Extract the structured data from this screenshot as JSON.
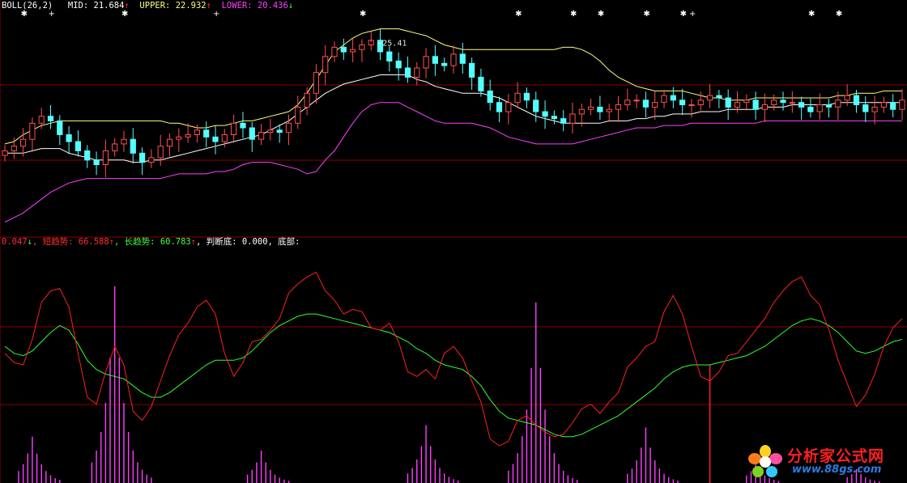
{
  "upper_panel": {
    "indicator": "BOLL(26,2)",
    "mid": {
      "label": "MID:",
      "value": "21.684",
      "arrow": "↑",
      "color": "#ffffff"
    },
    "upper": {
      "label": "UPPER:",
      "value": "22.932",
      "arrow": "↑",
      "color": "#ffff80"
    },
    "lower": {
      "label": "LOWER:",
      "value": "20.436",
      "arrow": "↓",
      "color": "#ff40ff"
    },
    "peak_annotation": "←25.41"
  },
  "lower_panel": {
    "lead_value": "0.047",
    "lead_arrow": "↓",
    "short_trend": {
      "label": "短趋势:",
      "value": "66.588",
      "arrow": "↑",
      "color": "#ff3030"
    },
    "long_trend": {
      "label": "长趋势:",
      "value": "60.783",
      "arrow": "↑",
      "color": "#40ff40"
    },
    "judge_bottom": {
      "label": "判断底:",
      "value": "0.000,"
    },
    "bottom": {
      "label": "底部:"
    }
  },
  "watermark": {
    "title": "分析家公式网",
    "url": "www.88gs.com"
  },
  "colors": {
    "background": "#000000",
    "rise_candle": "#ff5050",
    "fall_candle": "#54ffff",
    "boll_mid": "#ffffff",
    "boll_upper": "#ffff80",
    "boll_lower": "#ff40ff",
    "short_trend": "#ff2020",
    "long_trend": "#30ff30",
    "histogram": "#ff40ff",
    "grid": "#8b0000"
  },
  "chart_data": [
    {
      "type": "candlestick",
      "title": "BOLL(26,2)",
      "note": "approximate daily candles read off the price panel",
      "series": [
        {
          "name": "UPPER",
          "values": [
            21.0,
            21.1,
            21.4,
            21.6,
            21.8,
            21.9,
            22.0,
            22.0,
            22.0,
            22.0,
            22.0,
            22.0,
            22.0,
            22.0,
            22.0,
            22.0,
            22.0,
            22.0,
            21.9,
            21.9,
            21.8,
            21.7,
            21.7,
            21.8,
            21.8,
            21.9,
            22.0,
            22.0,
            22.1,
            22.2,
            22.3,
            22.4,
            22.7,
            23.2,
            23.8,
            24.4,
            25.0,
            25.3,
            25.6,
            25.8,
            25.9,
            26.0,
            26.0,
            26.0,
            25.9,
            25.8,
            25.7,
            25.5,
            25.3,
            25.2,
            25.1,
            25.1,
            25.1,
            25.1,
            25.1,
            25.1,
            25.1,
            25.1,
            25.1,
            25.1,
            25.1,
            25.2,
            25.2,
            25.1,
            24.9,
            24.6,
            24.2,
            23.9,
            23.7,
            23.5,
            23.4,
            23.3,
            23.3,
            23.3,
            23.3,
            23.2,
            23.1,
            23.0,
            23.0,
            22.9,
            22.9,
            22.9,
            23.0,
            23.0,
            23.0,
            23.0,
            23.0,
            23.0,
            23.0,
            23.0,
            23.0,
            23.1,
            23.1,
            23.2,
            23.2,
            23.2,
            23.3,
            23.3,
            23.3
          ]
        },
        {
          "name": "MID",
          "values": [
            20.6,
            20.6,
            20.6,
            20.7,
            20.8,
            20.8,
            20.8,
            20.6,
            20.5,
            20.4,
            20.3,
            20.3,
            20.3,
            20.3,
            20.2,
            20.2,
            20.3,
            20.3,
            20.4,
            20.5,
            20.6,
            20.7,
            20.8,
            20.9,
            21.0,
            21.1,
            21.2,
            21.3,
            21.4,
            21.6,
            21.8,
            22.0,
            22.3,
            22.6,
            22.9,
            23.2,
            23.4,
            23.6,
            23.7,
            23.8,
            23.9,
            24.0,
            24.0,
            24.0,
            24.0,
            23.8,
            23.7,
            23.5,
            23.4,
            23.3,
            23.2,
            23.2,
            23.2,
            23.1,
            23.0,
            22.8,
            22.6,
            22.4,
            22.2,
            22.1,
            22.0,
            21.9,
            21.9,
            21.9,
            21.9,
            21.9,
            22.0,
            22.0,
            22.0,
            22.1,
            22.1,
            22.2,
            22.2,
            22.3,
            22.3,
            22.3,
            22.4,
            22.4,
            22.4,
            22.5,
            22.5,
            22.5,
            22.5,
            22.6,
            22.6,
            22.6,
            22.7,
            22.7,
            22.7,
            22.7,
            22.7,
            22.8,
            22.8,
            22.8,
            22.8,
            22.8,
            22.8,
            22.8,
            22.8
          ]
        },
        {
          "name": "LOWER",
          "values": [
            17.6,
            17.8,
            18.0,
            18.3,
            18.6,
            18.9,
            19.1,
            19.3,
            19.4,
            19.5,
            19.5,
            19.5,
            19.5,
            19.5,
            19.5,
            19.5,
            19.5,
            19.5,
            19.6,
            19.7,
            19.7,
            19.7,
            19.7,
            19.8,
            19.8,
            19.9,
            20.1,
            20.2,
            20.2,
            20.2,
            20.1,
            20.0,
            19.9,
            19.7,
            19.8,
            20.3,
            20.7,
            21.3,
            21.9,
            22.4,
            22.7,
            22.8,
            22.8,
            22.8,
            22.6,
            22.4,
            22.2,
            22.0,
            21.9,
            21.9,
            21.9,
            21.9,
            21.8,
            21.7,
            21.5,
            21.3,
            21.2,
            21.1,
            21.0,
            21.0,
            21.0,
            21.0,
            21.0,
            21.1,
            21.2,
            21.3,
            21.4,
            21.5,
            21.6,
            21.7,
            21.7,
            21.7,
            21.8,
            21.8,
            21.8,
            21.9,
            21.9,
            21.9,
            21.9,
            21.9,
            21.9,
            21.9,
            21.9,
            22.0,
            22.0,
            22.0,
            22.0,
            22.0,
            22.0,
            22.0,
            22.0,
            22.0,
            22.0,
            22.0,
            22.0,
            22.0,
            22.0,
            22.0,
            22.0
          ]
        }
      ],
      "close": [
        20.7,
        20.9,
        21.2,
        21.9,
        22.2,
        22.0,
        21.4,
        21.1,
        20.7,
        20.3,
        20.1,
        20.7,
        21.0,
        21.2,
        20.6,
        20.2,
        20.4,
        20.9,
        21.2,
        21.3,
        21.4,
        21.6,
        21.3,
        21.1,
        21.4,
        21.9,
        21.7,
        21.2,
        21.5,
        21.6,
        21.5,
        21.9,
        22.6,
        23.2,
        24.1,
        24.8,
        25.2,
        25.0,
        25.1,
        25.3,
        25.5,
        25.0,
        24.6,
        24.3,
        23.9,
        24.3,
        24.8,
        24.5,
        24.4,
        24.9,
        24.5,
        23.9,
        23.3,
        22.8,
        22.4,
        22.8,
        23.2,
        22.9,
        22.4,
        22.2,
        22.1,
        21.9,
        22.3,
        22.5,
        22.6,
        22.4,
        22.5,
        22.7,
        22.9,
        22.9,
        22.6,
        22.8,
        23.1,
        22.9,
        22.7,
        22.7,
        22.9,
        23.1,
        23.0,
        22.6,
        22.8,
        22.9,
        22.5,
        22.7,
        22.9,
        22.8,
        22.8,
        22.6,
        22.4,
        22.7,
        22.6,
        22.9,
        23.1,
        22.7,
        22.4,
        22.6,
        22.8,
        22.5,
        22.9
      ],
      "peak": 25.41,
      "ylim": [
        17.2,
        26.9
      ]
    },
    {
      "type": "line",
      "series": [
        {
          "name": "短趋势",
          "values": [
            55,
            51,
            50,
            61,
            77,
            82,
            83,
            75,
            55,
            36,
            33,
            47,
            58,
            50,
            30,
            26,
            32,
            43,
            54,
            63,
            68,
            75,
            78,
            72,
            55,
            45,
            51,
            60,
            61,
            65,
            70,
            81,
            85,
            88,
            90,
            82,
            78,
            72,
            74,
            73,
            66,
            65,
            68,
            60,
            47,
            45,
            48,
            44,
            55,
            58,
            53,
            43,
            34,
            18,
            15,
            17,
            26,
            28,
            24,
            21,
            19,
            20,
            25,
            31,
            33,
            29,
            34,
            38,
            49,
            53,
            58,
            60,
            73,
            80,
            72,
            58,
            45,
            43,
            47,
            54,
            55,
            60,
            65,
            70,
            77,
            82,
            86,
            88,
            80,
            76,
            65,
            52,
            42,
            32,
            37,
            46,
            58,
            66,
            70
          ]
        },
        {
          "name": "长趋势",
          "values": [
            58,
            55,
            54,
            56,
            60,
            64,
            67,
            65,
            59,
            52,
            48,
            46,
            45,
            44,
            41,
            38,
            36,
            36,
            38,
            41,
            44,
            47,
            50,
            52,
            52,
            52,
            53,
            56,
            60,
            64,
            67,
            69,
            71,
            72,
            72,
            71,
            70,
            69,
            68,
            67,
            66,
            65,
            64,
            62,
            60,
            57,
            55,
            52,
            50,
            49,
            48,
            45,
            41,
            35,
            30,
            27,
            26,
            25,
            24,
            22,
            20,
            19,
            19,
            20,
            22,
            24,
            26,
            28,
            31,
            34,
            37,
            40,
            44,
            47,
            49,
            50,
            50,
            50,
            51,
            52,
            53,
            54,
            56,
            58,
            61,
            64,
            67,
            69,
            70,
            69,
            67,
            64,
            60,
            56,
            55,
            56,
            58,
            60,
            61
          ]
        }
      ],
      "histogram": [
        {
          "name": "底部",
          "note": "magenta decaying spike clusters near panel bottom"
        }
      ],
      "ylim": [
        0,
        100
      ]
    }
  ]
}
